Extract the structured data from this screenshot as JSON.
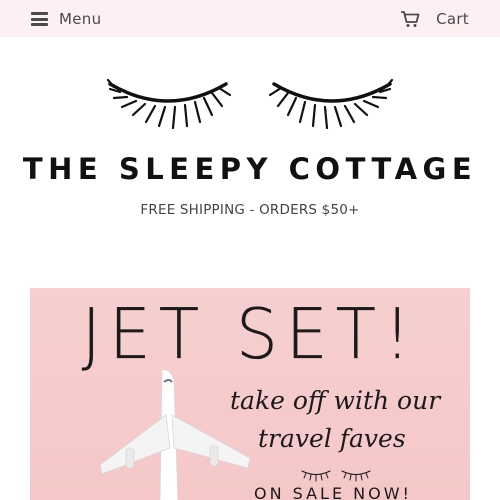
{
  "header": {
    "menu_label": "Menu",
    "cart_label": "Cart",
    "background": "#fdf0f3"
  },
  "brand": {
    "name": "THE SLEEPY COTTAGE",
    "tagline": "FREE SHIPPING - ORDERS $50+"
  },
  "hero": {
    "title": "JET SET!",
    "line1": "take off with our",
    "line2": "travel faves",
    "sale": "ON SALE NOW!",
    "background": "#f6cbcc"
  },
  "icons": {
    "menu": "hamburger-icon",
    "cart": "cart-icon",
    "logo": "eyelashes-logo",
    "plane": "airplane-image"
  }
}
